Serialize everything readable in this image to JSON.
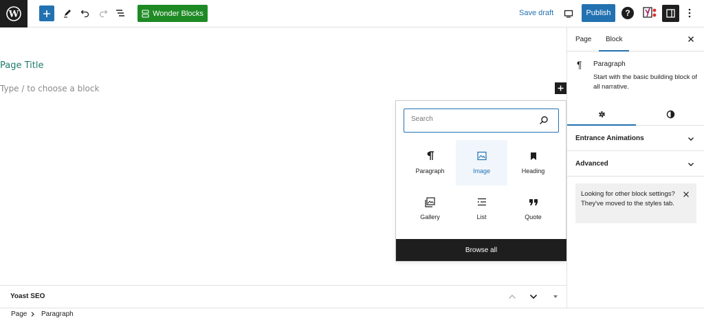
{
  "toolbar": {
    "logo_icon": "wordpress-logo-icon",
    "add_block_icon": "plus-icon",
    "tools_icon": "pencil-icon",
    "undo_icon": "undo-icon",
    "redo_icon": "redo-icon",
    "list_view_icon": "list-view-icon",
    "wonder_blocks_label": "Wonder Blocks",
    "save_draft_label": "Save draft",
    "preview_icon": "desktop-preview-icon",
    "publish_label": "Publish",
    "help_label": "?",
    "yoast_icon": "yoast-icon",
    "settings_icon": "sidebar-toggle-icon",
    "options_icon": "more-vertical-icon",
    "accent_color": "#2271b1",
    "wonder_color": "#1e8a24"
  },
  "editor": {
    "page_title": "Page Title",
    "block_placeholder": "Type / to choose a block"
  },
  "inserter": {
    "search_placeholder": "Search",
    "blocks": [
      {
        "label": "Paragraph",
        "icon": "paragraph-icon"
      },
      {
        "label": "Image",
        "icon": "image-icon",
        "active": true
      },
      {
        "label": "Heading",
        "icon": "bookmark-heading-icon"
      },
      {
        "label": "Gallery",
        "icon": "gallery-icon"
      },
      {
        "label": "List",
        "icon": "list-icon"
      },
      {
        "label": "Quote",
        "icon": "quote-icon"
      }
    ],
    "browse_all_label": "Browse all"
  },
  "yoast_panel": {
    "title": "Yoast SEO"
  },
  "footer": {
    "breadcrumbs": [
      "Page",
      "Paragraph"
    ]
  },
  "sidebar": {
    "tabs": [
      {
        "label": "Page"
      },
      {
        "label": "Block",
        "active": true
      }
    ],
    "block_card": {
      "icon": "¶",
      "title": "Paragraph",
      "description": "Start with the basic building block of all narrative."
    },
    "icon_tabs": [
      {
        "icon": "gear-icon",
        "active": true
      },
      {
        "icon": "styles-icon"
      }
    ],
    "panels": [
      {
        "title": "Entrance Animations"
      },
      {
        "title": "Advanced"
      }
    ],
    "notice": "Looking for other block settings? They've moved to the styles tab."
  }
}
